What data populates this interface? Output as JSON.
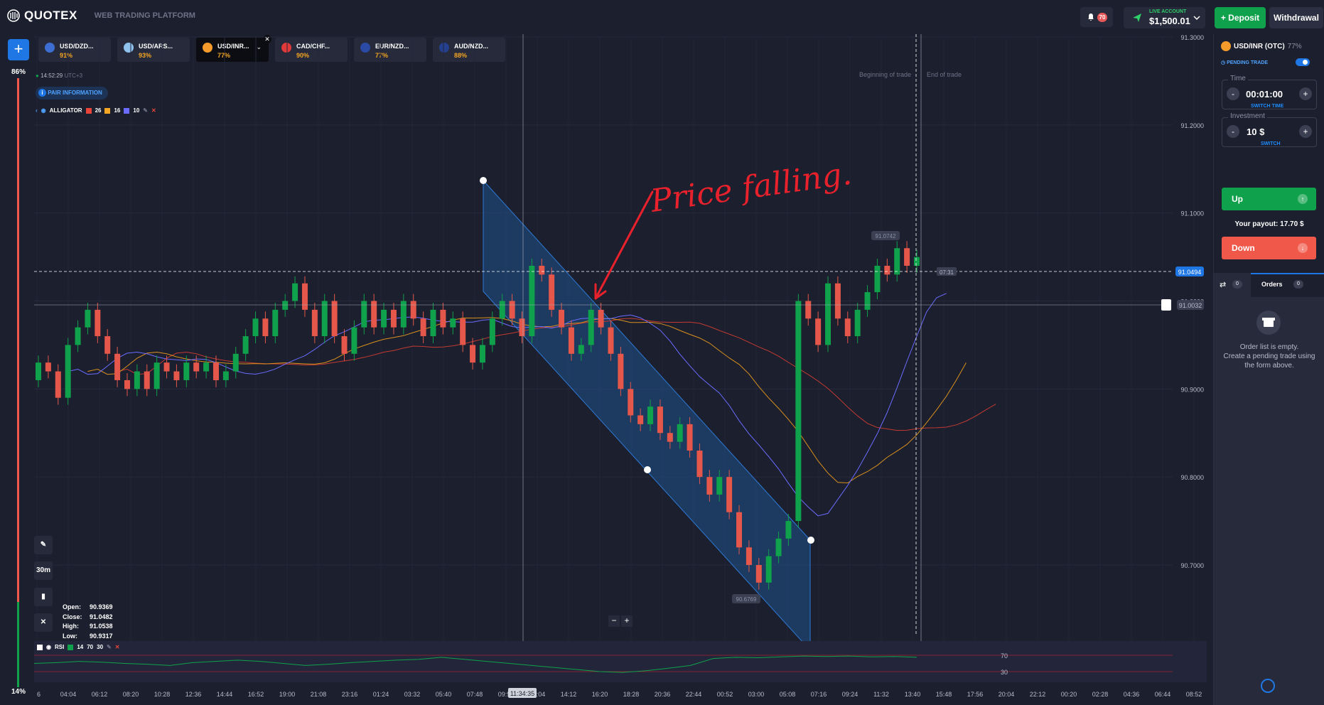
{
  "header": {
    "brand": "QUOTEX",
    "subtitle": "WEB TRADING PLATFORM",
    "notif_count": "70",
    "account_label": "LIVE ACCOUNT",
    "balance": "$1,500.01",
    "deposit_label": "Deposit",
    "withdrawal_label": "Withdrawal"
  },
  "tabs": [
    {
      "symbol": "USD/DZD...",
      "payout": "91%"
    },
    {
      "symbol": "USD/ARS...",
      "payout": "93%"
    },
    {
      "symbol": "USD/INR...",
      "payout": "77%"
    },
    {
      "symbol": "CAD/CHF...",
      "payout": "90%"
    },
    {
      "symbol": "EUR/NZD...",
      "payout": "77%"
    },
    {
      "symbol": "AUD/NZD...",
      "payout": "88%"
    }
  ],
  "sidebar": {
    "up_pct": "86%",
    "down_pct": "14%"
  },
  "chart_info": {
    "time": "14:52:29",
    "tz": "UTC+3",
    "pair_info": "PAIR INFORMATION",
    "indicator": "ALLIGATOR",
    "alligator_params": [
      "26",
      "16",
      "10"
    ],
    "rsi_label": "RSI",
    "rsi_params": [
      "14",
      "70",
      "30"
    ],
    "begin_trade": "Beginning of trade",
    "end_trade": "End of trade",
    "current_price": "91.0494",
    "alert_price": "91.0032",
    "high_label": "91.0742",
    "low_label": "90.6769",
    "timer": "07:31",
    "cursor_time": "11:34:35",
    "timeframe": "30m",
    "annotation": "Price falling."
  },
  "ohlc": {
    "open_label": "Open:",
    "open": "90.9369",
    "close_label": "Close:",
    "close": "91.0482",
    "high_label": "High:",
    "high": "91.0538",
    "low_label": "Low:",
    "low": "90.9317"
  },
  "y_axis": [
    "91.3000",
    "91.2000",
    "91.1000",
    "91.0000",
    "90.9000",
    "90.8000",
    "90.7000"
  ],
  "rsi_axis": [
    "70",
    "30"
  ],
  "x_axis": [
    "6",
    "04:04",
    "06:12",
    "08:20",
    "10:28",
    "12:36",
    "14:44",
    "16:52",
    "19:00",
    "21:08",
    "23:16",
    "01:24",
    "03:32",
    "05:40",
    "07:48",
    "09:56",
    "12:04",
    "14:12",
    "16:20",
    "18:28",
    "20:36",
    "22:44",
    "00:52",
    "03:00",
    "05:08",
    "07:16",
    "09:24",
    "11:32",
    "13:40",
    "15:48",
    "17:56",
    "20:04",
    "22:12",
    "00:20",
    "02:28",
    "04:36",
    "06:44",
    "08:52"
  ],
  "panel": {
    "pair": "USD/INR (OTC)",
    "payout": "77%",
    "pending": "PENDING TRADE",
    "time_label": "Time",
    "time_value": "00:01:00",
    "switch_time": "SWITCH TIME",
    "invest_label": "Investment",
    "invest_value": "10 $",
    "switch": "SWITCH",
    "up": "Up",
    "down": "Down",
    "payout_text": "Your payout: 17.70 $",
    "orders_tab": "Orders",
    "orders_count": "0",
    "other_count": "0",
    "empty_line1": "Order list is empty.",
    "empty_line2": "Create a pending trade using",
    "empty_line3": "the form above."
  },
  "chart_data": {
    "type": "candlestick",
    "y_range": [
      90.64,
      91.32
    ],
    "candles": [
      [
        90.91,
        90.93
      ],
      [
        90.93,
        90.92
      ],
      [
        90.92,
        90.89
      ],
      [
        90.89,
        90.95
      ],
      [
        90.95,
        90.97
      ],
      [
        90.97,
        90.99
      ],
      [
        90.99,
        90.96
      ],
      [
        90.96,
        90.94
      ],
      [
        90.94,
        90.91
      ],
      [
        90.91,
        90.9
      ],
      [
        90.9,
        90.92
      ],
      [
        90.92,
        90.9
      ],
      [
        90.9,
        90.93
      ],
      [
        90.93,
        90.92
      ],
      [
        90.92,
        90.91
      ],
      [
        90.91,
        90.93
      ],
      [
        90.93,
        90.92
      ],
      [
        90.92,
        90.93
      ],
      [
        90.93,
        90.91
      ],
      [
        90.91,
        90.92
      ],
      [
        90.92,
        90.94
      ],
      [
        90.94,
        90.96
      ],
      [
        90.96,
        90.98
      ],
      [
        90.98,
        90.96
      ],
      [
        90.96,
        90.99
      ],
      [
        90.99,
        91.0
      ],
      [
        91.0,
        91.02
      ],
      [
        91.02,
        90.99
      ],
      [
        90.99,
        90.96
      ],
      [
        90.96,
        91.0
      ],
      [
        91.0,
        90.96
      ],
      [
        90.96,
        90.94
      ],
      [
        90.94,
        90.97
      ],
      [
        90.97,
        91.0
      ],
      [
        91.0,
        90.97
      ],
      [
        90.97,
        90.99
      ],
      [
        90.99,
        90.97
      ],
      [
        90.97,
        91.0
      ],
      [
        91.0,
        90.98
      ],
      [
        90.98,
        90.96
      ],
      [
        90.96,
        90.99
      ],
      [
        90.99,
        90.97
      ],
      [
        90.97,
        90.98
      ],
      [
        90.98,
        90.95
      ],
      [
        90.95,
        90.93
      ],
      [
        90.93,
        90.95
      ],
      [
        90.95,
        90.98
      ],
      [
        90.98,
        91.0
      ],
      [
        91.0,
        90.98
      ],
      [
        90.98,
        90.96
      ],
      [
        90.96,
        91.04
      ],
      [
        91.04,
        91.03
      ],
      [
        91.03,
        90.99
      ],
      [
        90.99,
        90.97
      ],
      [
        90.97,
        90.94
      ],
      [
        90.94,
        90.95
      ],
      [
        90.95,
        90.99
      ],
      [
        90.99,
        90.97
      ],
      [
        90.97,
        90.94
      ],
      [
        90.94,
        90.9
      ],
      [
        90.9,
        90.87
      ],
      [
        90.87,
        90.86
      ],
      [
        90.86,
        90.88
      ],
      [
        90.88,
        90.85
      ],
      [
        90.85,
        90.84
      ],
      [
        90.84,
        90.86
      ],
      [
        90.86,
        90.83
      ],
      [
        90.83,
        90.8
      ],
      [
        90.8,
        90.78
      ],
      [
        90.78,
        90.8
      ],
      [
        90.8,
        90.76
      ],
      [
        90.76,
        90.72
      ],
      [
        90.72,
        90.7
      ],
      [
        90.7,
        90.68
      ],
      [
        90.68,
        90.71
      ],
      [
        90.71,
        90.73
      ],
      [
        90.73,
        90.75
      ],
      [
        90.75,
        91.0
      ],
      [
        91.0,
        90.98
      ],
      [
        90.98,
        90.95
      ],
      [
        90.95,
        91.02
      ],
      [
        91.02,
        90.98
      ],
      [
        90.98,
        90.96
      ],
      [
        90.96,
        90.99
      ],
      [
        90.99,
        91.01
      ],
      [
        91.01,
        91.04
      ],
      [
        91.04,
        91.03
      ],
      [
        91.03,
        91.06
      ],
      [
        91.06,
        91.04
      ],
      [
        91.04,
        91.05
      ]
    ],
    "rsi": [
      50,
      52,
      55,
      53,
      50,
      48,
      45,
      52,
      55,
      58,
      55,
      50,
      45,
      48,
      52,
      55,
      58,
      60,
      65,
      60,
      55,
      50,
      45,
      40,
      35,
      30,
      28,
      32,
      38,
      45,
      62,
      65,
      64,
      66,
      68,
      67,
      68,
      66,
      67,
      65
    ]
  }
}
